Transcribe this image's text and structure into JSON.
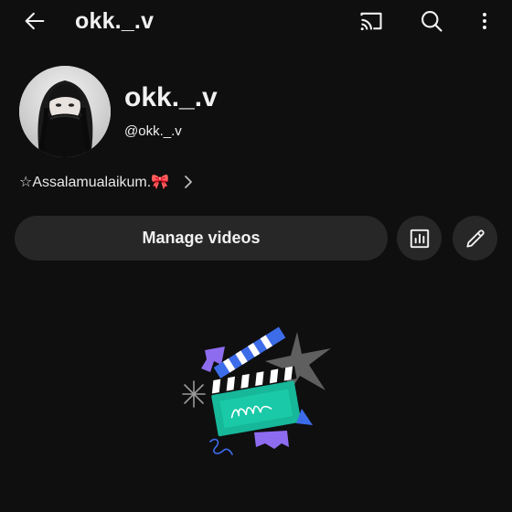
{
  "topbar": {
    "title": "okk._.v",
    "icons": [
      "back-arrow-icon",
      "cast-icon",
      "search-icon",
      "more-vert-icon"
    ]
  },
  "channel": {
    "name": "okk._.v",
    "handle": "@okk._.v",
    "description": "☆Assalamualaikum.🎀"
  },
  "actions": {
    "manage_videos_label": "Manage videos",
    "analytics_icon": "analytics-icon",
    "edit_icon": "pencil-icon"
  },
  "empty_state": {
    "illustration": "clapperboard-illustration"
  },
  "colors": {
    "background": "#0f0f0f",
    "button_bg": "#272727",
    "text": "#f1f1f1",
    "accent_teal": "#17b79a",
    "accent_purple": "#8e6cf0",
    "accent_blue": "#3d6ce9"
  }
}
